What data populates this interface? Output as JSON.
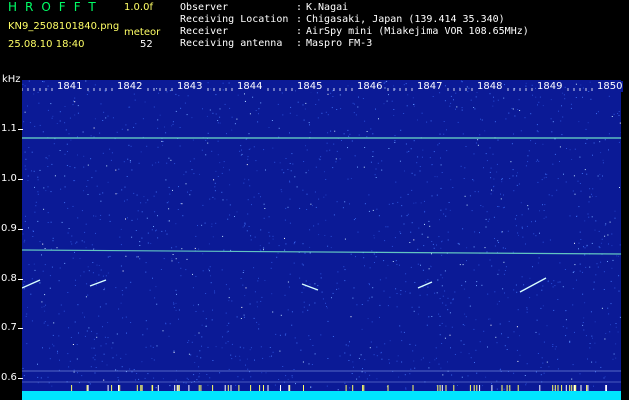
{
  "header": {
    "app_title": "HROFFT",
    "version": "1.0.0f",
    "filename": "KN9_2508101840.png",
    "meteor_label": "meteor",
    "datetime": "25.08.10 18:40",
    "meteor_count": "52"
  },
  "info": [
    {
      "label": "Observer",
      "value": "K.Nagai"
    },
    {
      "label": "Receiving Location",
      "value": "Chigasaki, Japan (139.414 35.340)"
    },
    {
      "label": "Receiver",
      "value": "AirSpy mini (Miakejima VOR 108.65MHz)"
    },
    {
      "label": "Receiving antenna",
      "value": "Maspro FM-3"
    }
  ],
  "axis": {
    "unit": "kHz",
    "y_labels": [
      "1.1",
      "1.0",
      "0.9",
      "0.8",
      "0.7",
      "0.6"
    ],
    "time_labels": [
      "1841",
      "1842",
      "1843",
      "1844",
      "1845",
      "1846",
      "1847",
      "1848",
      "1849",
      "1850"
    ]
  },
  "colors": {
    "background": "#000000",
    "spectrogram": "#0b1a96",
    "signal_line": "#7fffd0",
    "band": "#00e5ff",
    "title": "#00ff66",
    "meta": "#ffff66"
  }
}
